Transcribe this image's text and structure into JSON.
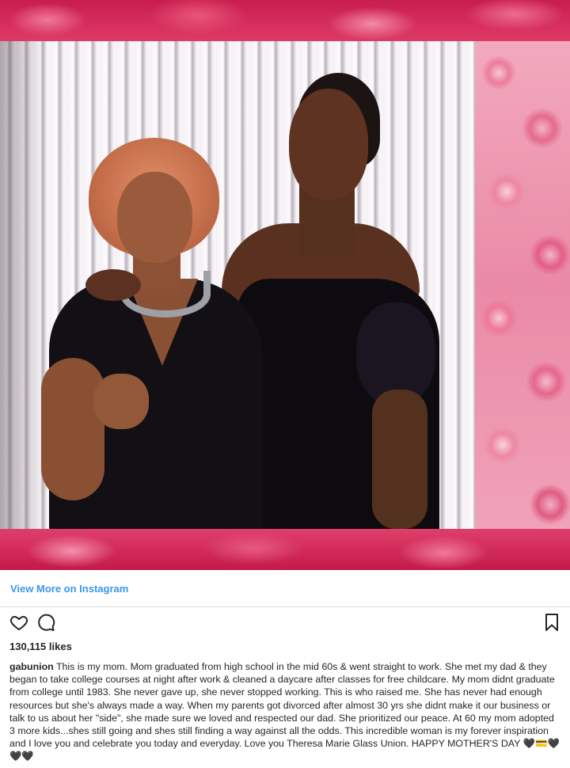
{
  "post": {
    "media_label": "Instagram video post",
    "view_more_label": "View More on Instagram",
    "likes": "130,115 likes",
    "username": "gabunion",
    "caption": "This is my mom. Mom graduated from high school in the mid 60s & went straight to work. She met my dad & they began to take college courses at night after work & cleaned a daycare after classes for free childcare. My mom didnt graduate from college until 1983. She never gave up, she never stopped working. This is who raised me. She has never had enough resources but she's always made a way. When my parents got divorced after almost 30 yrs she didnt make it our business or talk to us about her \"side\", she made sure we loved and respected our dad. She prioritized our peace. At 60 my mom adopted 3 more kids...shes still going and shes still finding a way against all the odds. This incredible woman is my forever inspiration and I love you and celebrate you today and everyday. Love you Theresa Marie Glass Union. HAPPY MOTHER'S DAY 🖤💳🖤🖤🖤"
  },
  "icons": {
    "like": "heart-icon",
    "comment": "comment-icon",
    "save": "bookmark-icon"
  },
  "colors": {
    "link": "#3897f0",
    "text": "#262626",
    "divider": "#dbdbdb",
    "rose": "#d8245a"
  }
}
